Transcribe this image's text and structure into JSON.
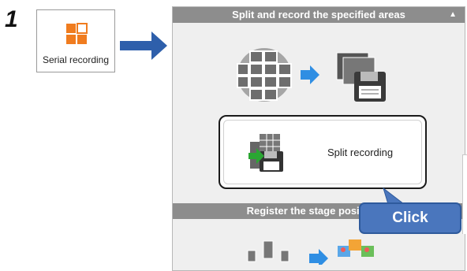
{
  "step_number": "1",
  "serial_recording": {
    "label": "Serial recording",
    "icon": "serial-recording-icon",
    "accent": "#f07c1f"
  },
  "panel": {
    "section1_title": "Split and record the specified areas",
    "collapse_icon": "▲",
    "split_button_label": "Split recording",
    "section2_title": "Register the stage position to"
  },
  "callout": {
    "text": "Click",
    "color": "#4a76bd"
  },
  "colors": {
    "arrow": "#2e5fab",
    "header": "#8d8d8d",
    "blue_arrow": "#2f8ee3",
    "green_arrow": "#2aa632"
  }
}
